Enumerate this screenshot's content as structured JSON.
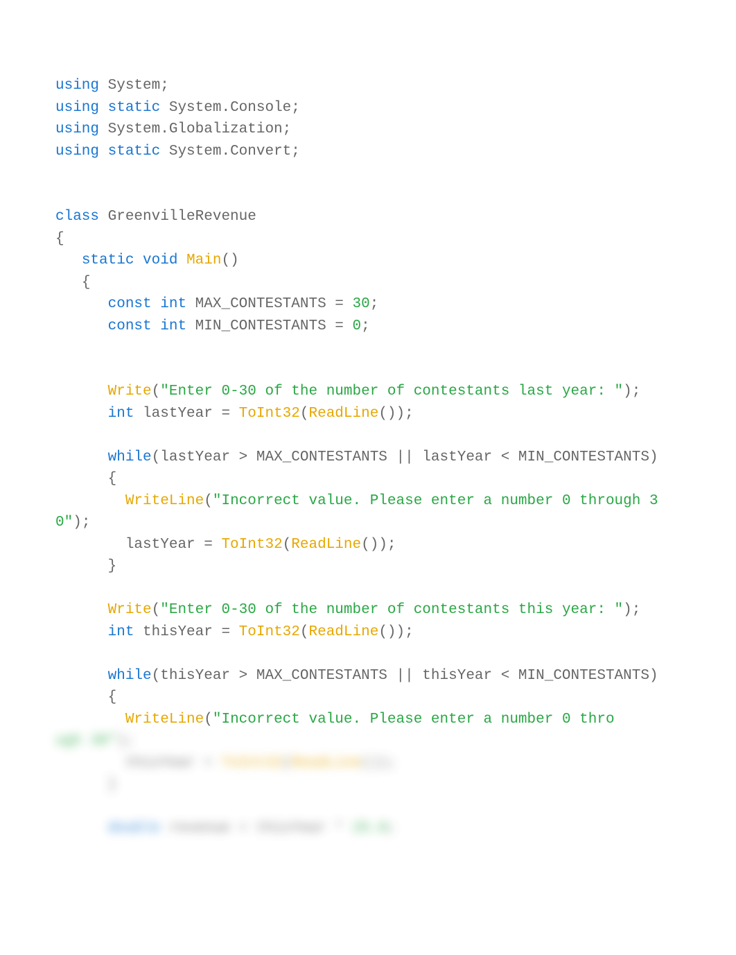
{
  "colors": {
    "keyword": "#1976d2",
    "function": "#e6a700",
    "literal": "#2aa745",
    "plain": "#666666",
    "background": "#ffffff"
  },
  "code": {
    "l01_kw_using1": "using",
    "l01_rest": " System;",
    "l02_kw_using": "using",
    "l02_kw_static": "static",
    "l02_rest": " System.Console;",
    "l03_kw_using": "using",
    "l03_rest": " System.Globalization;",
    "l04_kw_using": "using",
    "l04_kw_static": "static",
    "l04_rest": " System.Convert;",
    "l06_kw_class": "class",
    "l06_name": " GreenvilleRevenue",
    "l07_brace": "{",
    "l08_indent": "   ",
    "l08_kw_static": "static",
    "l08_kw_void": "void",
    "l08_fn_main": "Main",
    "l08_tail": "()",
    "l09_brace": "   {",
    "l10_indent": "      ",
    "l10_kw_const": "const",
    "l10_kw_int": "int",
    "l10_name": " MAX_CONTESTANTS = ",
    "l10_num": "30",
    "l10_semi": ";",
    "l11_indent": "      ",
    "l11_kw_const": "const",
    "l11_kw_int": "int",
    "l11_name": " MIN_CONTESTANTS = ",
    "l11_num": "0",
    "l11_semi": ";",
    "l14_indent": "      ",
    "l14_fn_write": "Write",
    "l14_paren": "(",
    "l14_str": "\"Enter 0-30 of the number of contestants last year: \"",
    "l14_tail": ");",
    "l15_indent": "      ",
    "l15_kw_int": "int",
    "l15_name": " lastYear = ",
    "l15_fn_toint": "ToInt32",
    "l15_paren": "(",
    "l15_fn_readline": "ReadLine",
    "l15_tail": "());",
    "l17_indent": "      ",
    "l17_kw_while": "while",
    "l17_tail": "(lastYear > MAX_CONTESTANTS || lastYear < MIN_CONTESTANTS)",
    "l18_brace": "      {",
    "l19_indent": "        ",
    "l19_fn_writeline": "WriteLine",
    "l19_paren": "(",
    "l19_str": "\"Incorrect value. Please enter a number 0 through 30\"",
    "l19_tail": ");",
    "l20_indent": "        lastYear = ",
    "l20_fn_toint": "ToInt32",
    "l20_paren": "(",
    "l20_fn_readline": "ReadLine",
    "l20_tail": "());",
    "l21_brace": "      }",
    "l23_indent": "      ",
    "l23_fn_write": "Write",
    "l23_paren": "(",
    "l23_str": "\"Enter 0-30 of the number of contestants this year: \"",
    "l23_tail": ");",
    "l24_indent": "      ",
    "l24_kw_int": "int",
    "l24_name": " thisYear = ",
    "l24_fn_toint": "ToInt32",
    "l24_paren": "(",
    "l24_fn_readline": "ReadLine",
    "l24_tail": "());",
    "l26_indent": "      ",
    "l26_kw_while": "while",
    "l26_tail": "(thisYear > MAX_CONTESTANTS || thisYear < MIN_CONTESTANTS)",
    "l27_brace": "      {",
    "l28_indent": "        ",
    "l28_fn_writeline": "WriteLine",
    "l28_paren": "(",
    "l28_str": "\"Incorrect value. Please enter a number 0 thro",
    "blur1_a": "ugh 30\"",
    "blur1_b": ");",
    "blur2_indent": "        thisYear = ",
    "blur2_fn_toint": "ToInt32",
    "blur2_paren": "(",
    "blur2_fn_readline": "ReadLine",
    "blur2_tail": "());",
    "blur3_brace": "      }",
    "blur4_indent": "      ",
    "blur4_kw": "double",
    "blur4_rest": " revenue = thisYear * ",
    "blur4_num": "25.0",
    "blur4_semi": ";"
  }
}
